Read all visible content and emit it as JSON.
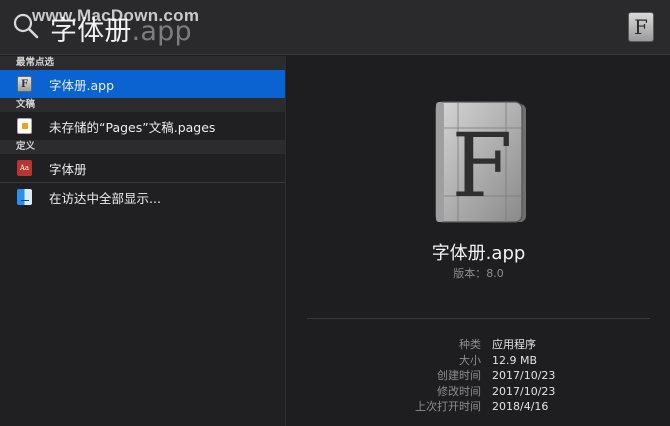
{
  "search": {
    "query": "字体册",
    "completion": ".app",
    "watermark": "www.MacDown.com",
    "top_icon_glyph": "F"
  },
  "results": {
    "sections": [
      {
        "header": "最常点选",
        "items": [
          {
            "label": "字体册.app",
            "icon": "font-book-icon",
            "selected": true
          }
        ]
      },
      {
        "header": "文稿",
        "items": [
          {
            "label": "未存储的“Pages”文稿.pages",
            "icon": "pages-document-icon",
            "selected": false
          }
        ]
      },
      {
        "header": "定义",
        "items": [
          {
            "label": "字体册",
            "icon": "dictionary-icon",
            "selected": false
          }
        ]
      }
    ],
    "show_all_label": "在访达中全部显示...",
    "show_all_icon": "finder-icon",
    "icon_glyphs": {
      "font_book": "F",
      "dictionary": "Aa"
    }
  },
  "preview": {
    "app_name": "字体册.app",
    "version_label": "版本：",
    "version_value": "8.0",
    "icon_glyph": "F",
    "details": [
      {
        "key": "种类",
        "value": "应用程序"
      },
      {
        "key": "大小",
        "value": "12.9 MB"
      },
      {
        "key": "创建时间",
        "value": "2017/10/23"
      },
      {
        "key": "修改时间",
        "value": "2017/10/23"
      },
      {
        "key": "上次打开时间",
        "value": "2018/4/16"
      }
    ]
  },
  "colors": {
    "selection": "#0b63d1",
    "background": "#1c1c1e",
    "secondary_text": "#8e8e92"
  }
}
